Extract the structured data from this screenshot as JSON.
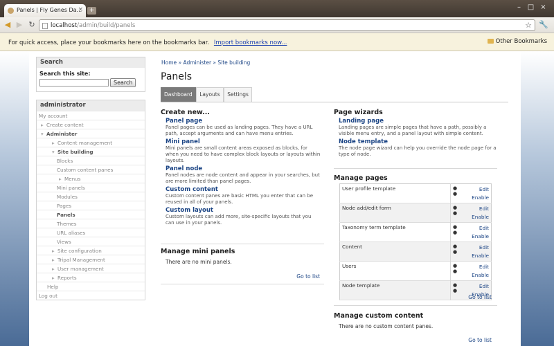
{
  "browser": {
    "tab_title": "Panels | Fly Genes Da...",
    "new_tab_label": "+",
    "url_host": "localhost",
    "url_path": "/admin/build/panels",
    "bookmarks_text": "For quick access, place your bookmarks here on the bookmarks bar.",
    "bookmarks_import": "Import bookmarks now...",
    "other_bookmarks": "Other Bookmarks"
  },
  "search_block": {
    "title": "Search",
    "label": "Search this site:",
    "button": "Search"
  },
  "admin_block": {
    "title": "administrator",
    "items": [
      {
        "label": "My account"
      },
      {
        "label": "Create content"
      },
      {
        "label": "Administer"
      },
      {
        "label": "Content management"
      },
      {
        "label": "Site building"
      },
      {
        "label": "Blocks"
      },
      {
        "label": "Custom content panes"
      },
      {
        "label": "Menus"
      },
      {
        "label": "Mini panels"
      },
      {
        "label": "Modules"
      },
      {
        "label": "Pages"
      },
      {
        "label": "Panels"
      },
      {
        "label": "Themes"
      },
      {
        "label": "URL aliases"
      },
      {
        "label": "Views"
      },
      {
        "label": "Site configuration"
      },
      {
        "label": "Tripal Management"
      },
      {
        "label": "User management"
      },
      {
        "label": "Reports"
      },
      {
        "label": "Help"
      },
      {
        "label": "Log out"
      }
    ]
  },
  "breadcrumb": "Home » Administer » Site building",
  "page_title": "Panels",
  "tabs": [
    {
      "label": "Dashboard"
    },
    {
      "label": "Layouts"
    },
    {
      "label": "Settings"
    }
  ],
  "create_new": {
    "heading": "Create new...",
    "items": [
      {
        "link": "Panel page",
        "desc": "Panel pages can be used as landing pages. They have a URL path, accept arguments and can have menu entries."
      },
      {
        "link": "Mini panel",
        "desc": "Mini panels are small content areas exposed as blocks, for when you need to have complex block layouts or layouts within layouts."
      },
      {
        "link": "Panel node",
        "desc": "Panel nodes are node content and appear in your searches, but are more limited than panel pages."
      },
      {
        "link": "Custom content",
        "desc": "Custom content panes are basic HTML you enter that can be reused in all of your panels."
      },
      {
        "link": "Custom layout",
        "desc": "Custom layouts can add more, site-specific layouts that you can use in your panels."
      }
    ]
  },
  "mini_panels": {
    "heading": "Manage mini panels",
    "empty": "There are no mini panels.",
    "goto": "Go to list"
  },
  "wizards": {
    "heading": "Page wizards",
    "items": [
      {
        "link": "Landing page",
        "desc": "Landing pages are simple pages that have a path, possibly a visible menu entry, and a panel layout with simple content."
      },
      {
        "link": "Node template",
        "desc": "The node page wizard can help you override the node page for a type of node."
      }
    ]
  },
  "manage_pages": {
    "heading": "Manage pages",
    "rows": [
      {
        "name": "User profile template",
        "edit": "Edit",
        "enable": "Enable"
      },
      {
        "name": "Node add/edit form",
        "edit": "Edit",
        "enable": "Enable"
      },
      {
        "name": "Taxonomy term template",
        "edit": "Edit",
        "enable": "Enable"
      },
      {
        "name": "Content",
        "edit": "Edit",
        "enable": "Enable"
      },
      {
        "name": "Users",
        "edit": "Edit",
        "enable": "Enable"
      },
      {
        "name": "Node template",
        "edit": "Edit",
        "enable": "Enable"
      }
    ],
    "goto": "Go to list"
  },
  "custom_content": {
    "heading": "Manage custom content",
    "empty": "There are no custom content panes.",
    "goto": "Go to list"
  }
}
